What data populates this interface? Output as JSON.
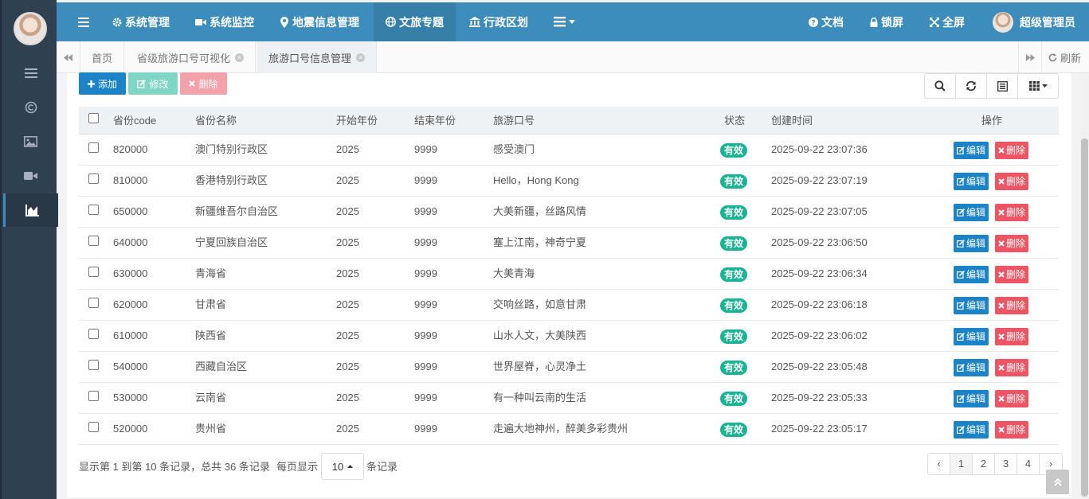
{
  "nav": {
    "items": [
      {
        "label": "系统管理",
        "icon": "gear-icon"
      },
      {
        "label": "系统监控",
        "icon": "video-icon"
      },
      {
        "label": "地震信息管理",
        "icon": "map-pin-icon"
      },
      {
        "label": "文旅专题",
        "icon": "globe-icon"
      },
      {
        "label": "行政区划",
        "icon": "bank-icon"
      }
    ],
    "right": {
      "docs": "文档",
      "lock": "锁屏",
      "fullscreen": "全屏",
      "user": "超级管理员"
    }
  },
  "tabs": {
    "items": [
      {
        "label": "首页"
      },
      {
        "label": "省级旅游口号可视化"
      },
      {
        "label": "旅游口号信息管理"
      }
    ],
    "refresh": "刷新"
  },
  "toolbar": {
    "add": "添加",
    "edit": "修改",
    "delete": "删除"
  },
  "table": {
    "headers": {
      "code": "省份code",
      "name": "省份名称",
      "start": "开始年份",
      "end": "结束年份",
      "slogan": "旅游口号",
      "status": "状态",
      "created": "创建时间",
      "ops": "操作"
    },
    "rows": [
      {
        "code": "820000",
        "name": "澳门特别行政区",
        "start": "2025",
        "end": "9999",
        "slogan": "感受澳门",
        "status": "有效",
        "created": "2025-09-22 23:07:36"
      },
      {
        "code": "810000",
        "name": "香港特别行政区",
        "start": "2025",
        "end": "9999",
        "slogan": "Hello，Hong Kong",
        "status": "有效",
        "created": "2025-09-22 23:07:19"
      },
      {
        "code": "650000",
        "name": "新疆维吾尔自治区",
        "start": "2025",
        "end": "9999",
        "slogan": "大美新疆，丝路风情",
        "status": "有效",
        "created": "2025-09-22 23:07:05"
      },
      {
        "code": "640000",
        "name": "宁夏回族自治区",
        "start": "2025",
        "end": "9999",
        "slogan": "塞上江南，神奇宁夏",
        "status": "有效",
        "created": "2025-09-22 23:06:50"
      },
      {
        "code": "630000",
        "name": "青海省",
        "start": "2025",
        "end": "9999",
        "slogan": "大美青海",
        "status": "有效",
        "created": "2025-09-22 23:06:34"
      },
      {
        "code": "620000",
        "name": "甘肃省",
        "start": "2025",
        "end": "9999",
        "slogan": "交响丝路，如意甘肃",
        "status": "有效",
        "created": "2025-09-22 23:06:18"
      },
      {
        "code": "610000",
        "name": "陕西省",
        "start": "2025",
        "end": "9999",
        "slogan": "山水人文，大美陕西",
        "status": "有效",
        "created": "2025-09-22 23:06:02"
      },
      {
        "code": "540000",
        "name": "西藏自治区",
        "start": "2025",
        "end": "9999",
        "slogan": "世界屋脊，心灵净土",
        "status": "有效",
        "created": "2025-09-22 23:05:48"
      },
      {
        "code": "530000",
        "name": "云南省",
        "start": "2025",
        "end": "9999",
        "slogan": "有一种叫云南的生活",
        "status": "有效",
        "created": "2025-09-22 23:05:33"
      },
      {
        "code": "520000",
        "name": "贵州省",
        "start": "2025",
        "end": "9999",
        "slogan": "走遍大地神州，醉美多彩贵州",
        "status": "有效",
        "created": "2025-09-22 23:05:17"
      }
    ],
    "row_edit": "编辑",
    "row_delete": "删除"
  },
  "footer": {
    "summary": "显示第 1 到第 10 条记录，总共 36 条记录",
    "per_page_prefix": "每页显示",
    "page_size": "10",
    "per_page_suffix": "条记录",
    "pages": [
      "‹",
      "1",
      "2",
      "3",
      "4",
      "›"
    ]
  },
  "colors": {
    "sidebar": "#2f4050",
    "navbar": "#3c8dbc",
    "success": "#1ab394",
    "primary": "#1c84c6",
    "danger": "#ed5565"
  }
}
